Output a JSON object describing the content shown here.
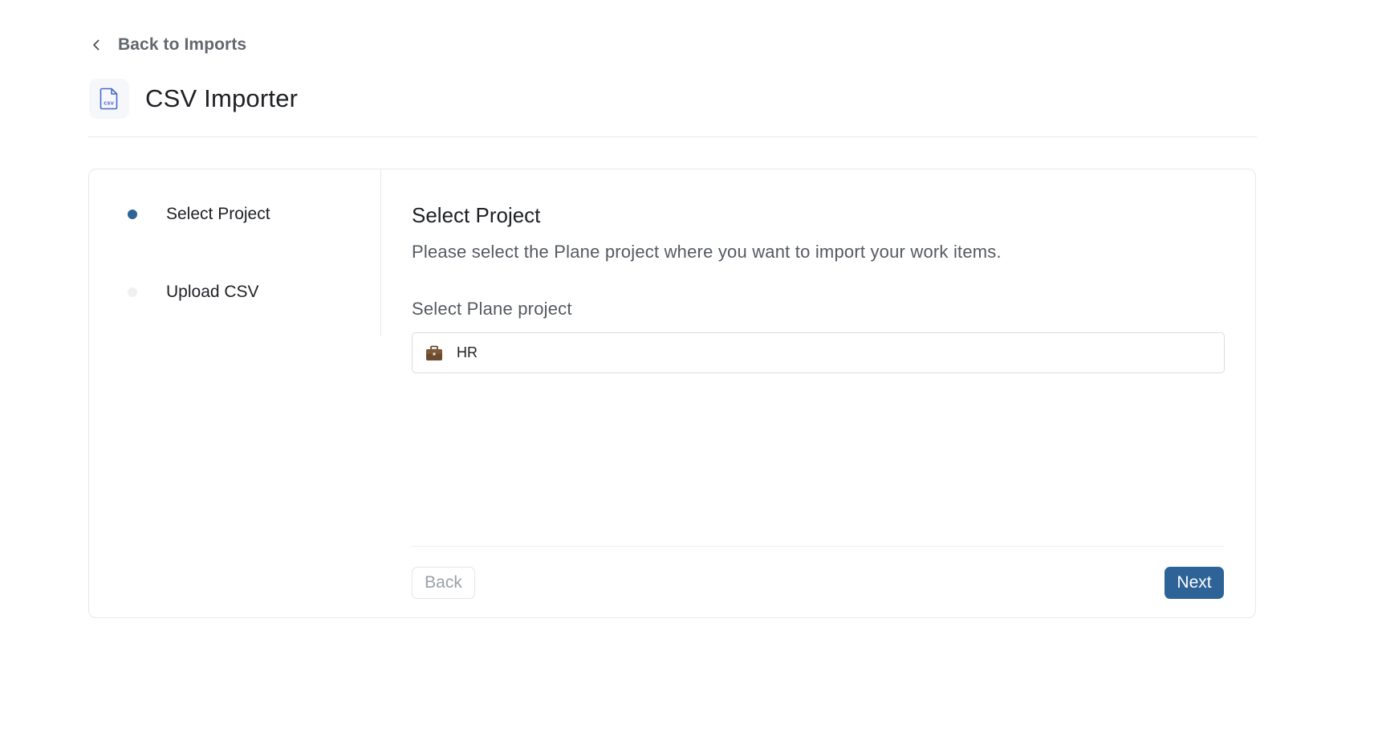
{
  "back_link": {
    "label": "Back to Imports",
    "icon": "chevron-left-icon"
  },
  "header": {
    "icon": "csv-file-icon",
    "title": "CSV Importer"
  },
  "steps": [
    {
      "label": "Select Project",
      "state": "active",
      "dot_color": "#2d6396"
    },
    {
      "label": "Upload CSV",
      "state": "inactive",
      "dot_color": "#eef0f2"
    }
  ],
  "main": {
    "title": "Select Project",
    "description": "Please select the Plane project where you want to import your work items.",
    "field_label": "Select Plane project",
    "project_select": {
      "icon": "briefcase-icon",
      "value": "HR"
    }
  },
  "footer": {
    "back_label": "Back",
    "next_label": "Next"
  },
  "colors": {
    "accent": "#2d6396",
    "border": "#e6e8eb",
    "csv_icon": "#4a68c9"
  }
}
